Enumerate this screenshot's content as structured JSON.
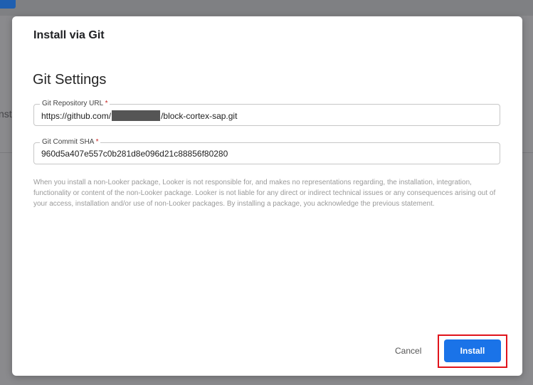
{
  "background": {
    "partial_text": "nst"
  },
  "dialog": {
    "title": "Install via Git",
    "section_title": "Git Settings",
    "fields": {
      "repo_url": {
        "label": "Git Repository URL",
        "required_mark": "*",
        "value_prefix": "https://github.com/",
        "value_suffix": "/block-cortex-sap.git"
      },
      "commit_sha": {
        "label": "Git Commit SHA",
        "required_mark": "*",
        "value": "960d5a407e557c0b281d8e096d21c88856f80280"
      }
    },
    "disclaimer": "When you install a non-Looker package, Looker is not responsible for, and makes no representations regarding, the installation, integration, functionality or content of the non-Looker package. Looker is not liable for any direct or indirect technical issues or any consequences arising out of your access, installation and/or use of non-Looker packages. By installing a package, you acknowledge the previous statement.",
    "buttons": {
      "cancel": "Cancel",
      "install": "Install"
    }
  },
  "colors": {
    "primary": "#1a73e8",
    "highlight": "#e0131b",
    "required": "#c5221f"
  }
}
